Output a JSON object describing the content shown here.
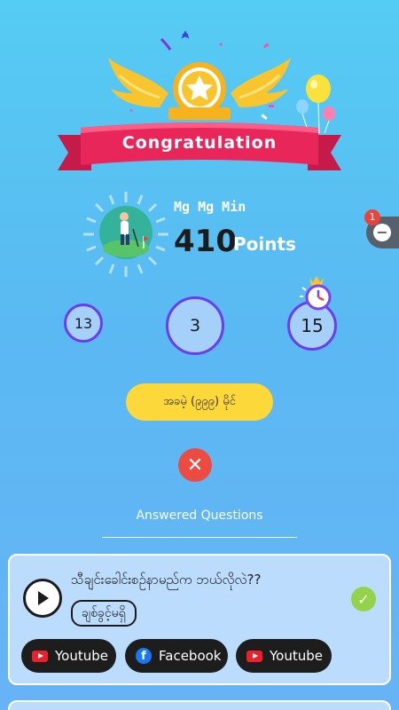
{
  "header": {
    "ribbon_text": "Congratulation"
  },
  "user": {
    "name": "Mg Mg Min",
    "points_value": "410",
    "points_label": "Points"
  },
  "side_widget": {
    "badge_count": "1",
    "minus_symbol": "−"
  },
  "stats": {
    "left": "13",
    "center": "3",
    "right": "15"
  },
  "action_button": {
    "label": "အခမဲ့ (၉၉၉) မိုင်"
  },
  "close_symbol": "✕",
  "section": {
    "answered_title": "Answered Questions"
  },
  "question_card": {
    "question": "သီချင်းခေါင်းစဉ်နာမည်က ဘယ်လိုလဲ??",
    "answer": "ချစ်ခွင့်မရှိ",
    "check_symbol": "✓",
    "links": [
      {
        "label": "Youtube",
        "icon": "youtube-icon"
      },
      {
        "label": "Facebook",
        "icon": "facebook-icon"
      },
      {
        "label": "Youtube",
        "icon": "youtube-icon"
      }
    ]
  },
  "colors": {
    "ribbon": "#e8265a",
    "gold": "#f7c12c",
    "circle_border": "#6a3df0",
    "circle_fill": "#a5d0fa",
    "yellow_button": "#fcd83a",
    "close_red": "#ec4b42",
    "check_green": "#93d34a"
  }
}
